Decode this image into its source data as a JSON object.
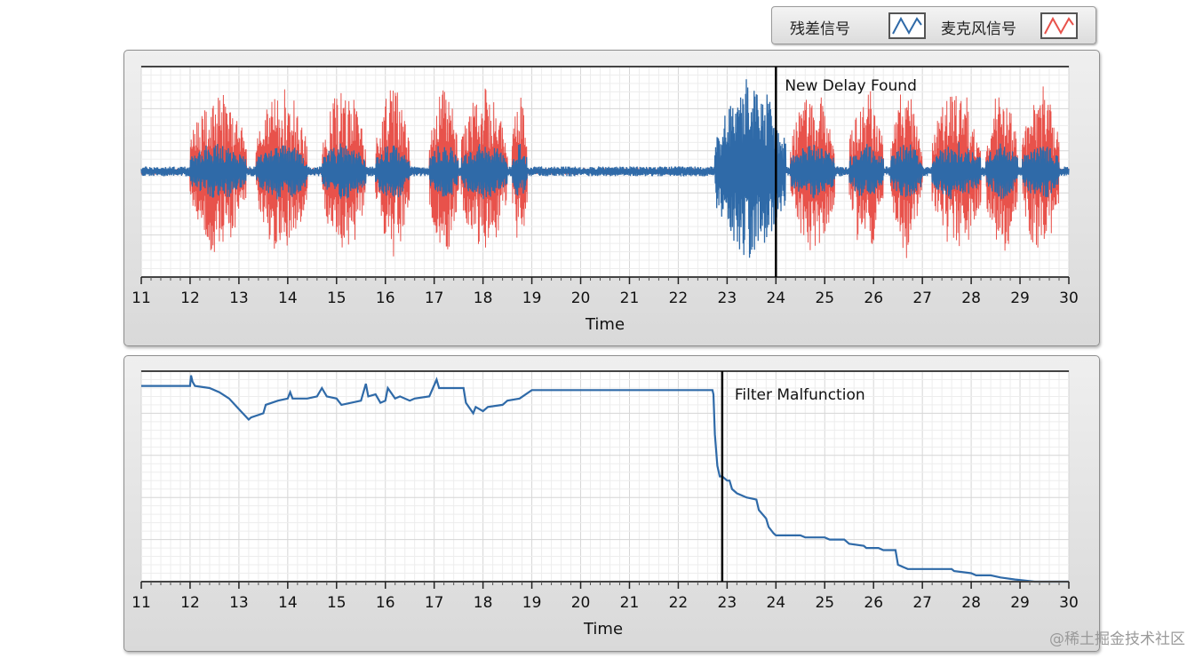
{
  "legend": {
    "items": [
      {
        "label": "残差信号",
        "color": "#2f6aa8"
      },
      {
        "label": "麦克风信号",
        "color": "#e8524b"
      }
    ]
  },
  "watermark": "@稀土掘金技术社区",
  "chart_data": [
    {
      "type": "line",
      "xlabel": "Time",
      "xlim": [
        11,
        30
      ],
      "xticks": [
        11,
        12,
        13,
        14,
        15,
        16,
        17,
        18,
        19,
        20,
        21,
        22,
        23,
        24,
        25,
        26,
        27,
        28,
        29,
        30
      ],
      "grid": true,
      "annotation": {
        "text": "New Delay Found",
        "x": 24
      },
      "series": [
        {
          "name": "麦克风信号",
          "color": "#e8524b",
          "bursts": [
            [
              12.0,
              13.15
            ],
            [
              13.35,
              14.4
            ],
            [
              14.7,
              15.6
            ],
            [
              15.8,
              16.5
            ],
            [
              16.9,
              17.5
            ],
            [
              17.55,
              18.5
            ],
            [
              18.6,
              18.9
            ],
            [
              24.3,
              25.2
            ],
            [
              25.5,
              26.2
            ],
            [
              26.35,
              27.0
            ],
            [
              27.2,
              28.2
            ],
            [
              28.3,
              28.95
            ],
            [
              29.05,
              29.8
            ]
          ],
          "peak_amplitude": 0.9
        },
        {
          "name": "残差信号",
          "color": "#2f6aa8",
          "bursts": [
            [
              22.75,
              24.2
            ]
          ],
          "peak_amplitude": 0.95
        }
      ]
    },
    {
      "type": "line",
      "xlabel": "Time",
      "xlim": [
        11,
        30
      ],
      "ylim": [
        0,
        1
      ],
      "xticks": [
        11,
        12,
        13,
        14,
        15,
        16,
        17,
        18,
        19,
        20,
        21,
        22,
        23,
        24,
        25,
        26,
        27,
        28,
        29,
        30
      ],
      "grid": true,
      "annotation": {
        "text": "Filter Malfunction",
        "x": 22.9
      },
      "series": [
        {
          "color": "#2f6aa8",
          "x": [
            11,
            12,
            12.02,
            12.05,
            12.1,
            12.4,
            12.6,
            12.8,
            13.0,
            13.2,
            13.25,
            13.5,
            13.55,
            13.8,
            14.0,
            14.05,
            14.1,
            14.4,
            14.6,
            14.7,
            14.8,
            15.0,
            15.1,
            15.3,
            15.5,
            15.6,
            15.65,
            15.8,
            15.9,
            16.0,
            16.05,
            16.2,
            16.3,
            16.5,
            16.6,
            16.9,
            17.05,
            17.1,
            17.3,
            17.6,
            17.65,
            17.8,
            17.85,
            18.0,
            18.1,
            18.4,
            18.5,
            18.75,
            19.0,
            19.3,
            22.7,
            22.72,
            22.75,
            22.8,
            22.85,
            22.9,
            23.0,
            23.05,
            23.1,
            23.2,
            23.4,
            23.6,
            23.65,
            23.8,
            23.85,
            23.95,
            24.0,
            24.5,
            24.6,
            25.0,
            25.1,
            25.4,
            25.5,
            25.8,
            25.85,
            26.1,
            26.2,
            26.45,
            26.5,
            26.7,
            27.6,
            27.65,
            28.0,
            28.1,
            28.4,
            28.6,
            28.9,
            29.3,
            30.0
          ],
          "y": [
            0.93,
            0.93,
            0.98,
            0.95,
            0.93,
            0.92,
            0.9,
            0.87,
            0.82,
            0.77,
            0.78,
            0.8,
            0.84,
            0.86,
            0.87,
            0.9,
            0.87,
            0.87,
            0.88,
            0.92,
            0.88,
            0.87,
            0.84,
            0.85,
            0.86,
            0.94,
            0.88,
            0.89,
            0.85,
            0.86,
            0.92,
            0.87,
            0.88,
            0.86,
            0.87,
            0.88,
            0.96,
            0.92,
            0.92,
            0.92,
            0.85,
            0.8,
            0.83,
            0.81,
            0.83,
            0.84,
            0.86,
            0.87,
            0.91,
            0.91,
            0.91,
            0.89,
            0.7,
            0.55,
            0.5,
            0.5,
            0.48,
            0.48,
            0.44,
            0.42,
            0.4,
            0.39,
            0.34,
            0.3,
            0.26,
            0.23,
            0.22,
            0.22,
            0.21,
            0.21,
            0.2,
            0.2,
            0.18,
            0.17,
            0.16,
            0.16,
            0.15,
            0.15,
            0.08,
            0.06,
            0.06,
            0.05,
            0.04,
            0.03,
            0.03,
            0.02,
            0.01,
            0.0,
            0.0
          ]
        }
      ]
    }
  ]
}
